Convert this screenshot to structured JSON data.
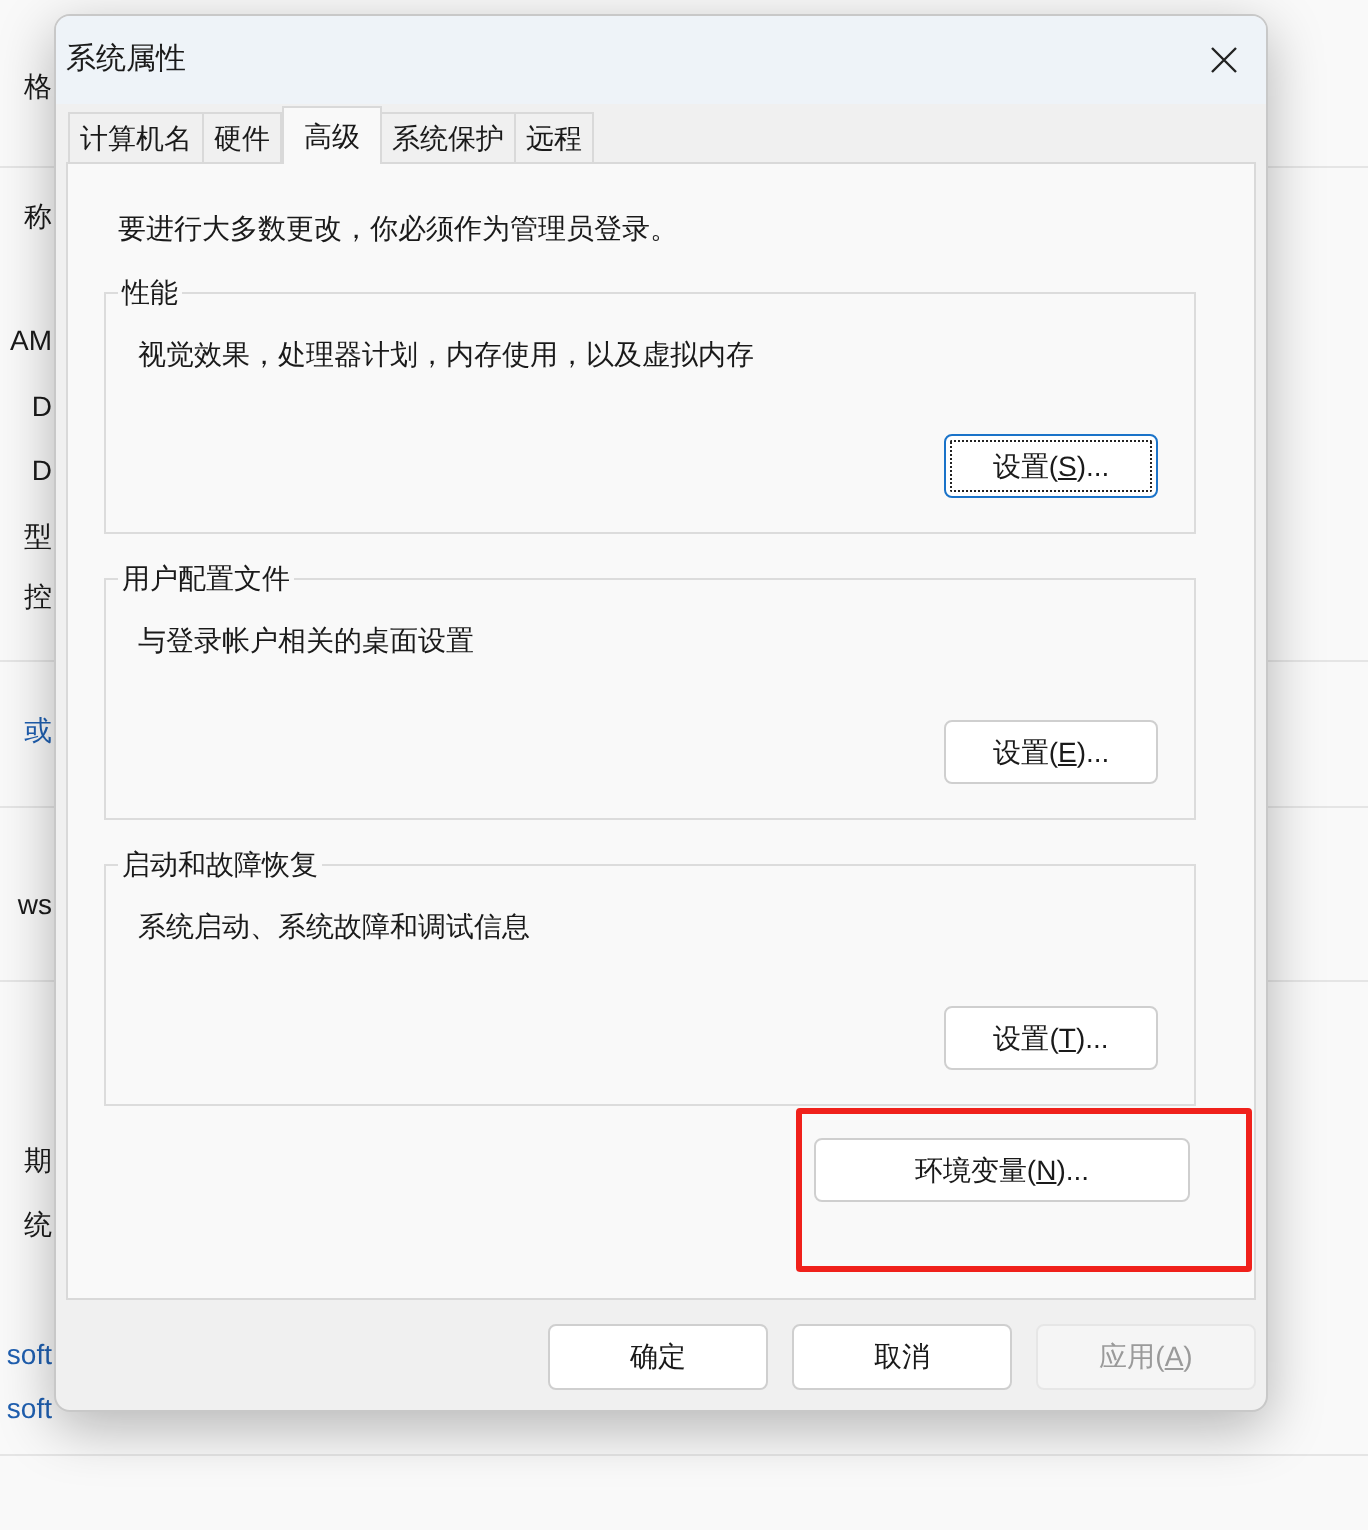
{
  "background": {
    "texts": [
      {
        "text": "格",
        "link": false
      },
      {
        "text": "称",
        "link": false
      },
      {
        "text": "AM",
        "link": false
      },
      {
        "text": "D",
        "link": false
      },
      {
        "text": "D",
        "link": false
      },
      {
        "text": "型",
        "link": false
      },
      {
        "text": "控",
        "link": false
      },
      {
        "text": "或",
        "link": true
      },
      {
        "text": "ws",
        "link": false
      },
      {
        "text": "期",
        "link": false
      },
      {
        "text": "统",
        "link": false
      },
      {
        "text": "soft",
        "link": true
      },
      {
        "text": "soft",
        "link": true
      }
    ]
  },
  "dialog": {
    "title": "系统属性",
    "tabs": [
      {
        "label": "计算机名",
        "selected": false
      },
      {
        "label": "硬件",
        "selected": false
      },
      {
        "label": "高级",
        "selected": true
      },
      {
        "label": "系统保护",
        "selected": false
      },
      {
        "label": "远程",
        "selected": false
      }
    ],
    "notice": "要进行大多数更改，你必须作为管理员登录。",
    "groups": [
      {
        "title": "性能",
        "description": "视觉效果，处理器计划，内存使用，以及虚拟内存",
        "button": {
          "before": "设置(",
          "key": "S",
          "after": ")...",
          "focused": true
        }
      },
      {
        "title": "用户配置文件",
        "description": "与登录帐户相关的桌面设置",
        "button": {
          "before": "设置(",
          "key": "E",
          "after": ")...",
          "focused": false
        }
      },
      {
        "title": "启动和故障恢复",
        "description": "系统启动、系统故障和调试信息",
        "button": {
          "before": "设置(",
          "key": "T",
          "after": ")...",
          "focused": false
        }
      }
    ],
    "environment_button": {
      "before": "环境变量(",
      "key": "N",
      "after": ")...",
      "highlighted": true
    },
    "footer_buttons": [
      {
        "before": "确定",
        "disabled": false
      },
      {
        "before": "取消",
        "disabled": false
      },
      {
        "before": "应用(",
        "key": "A",
        "after": ")",
        "disabled": true
      }
    ]
  }
}
